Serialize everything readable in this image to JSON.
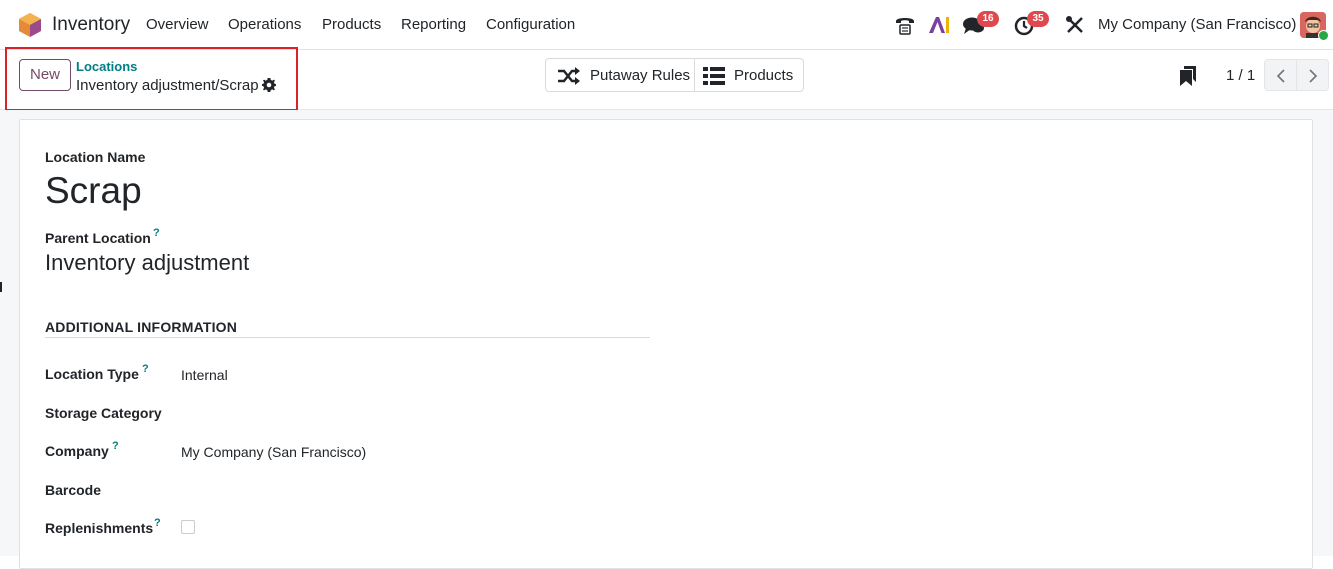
{
  "app": {
    "name": "Inventory"
  },
  "menu": [
    "Overview",
    "Operations",
    "Products",
    "Reporting",
    "Configuration"
  ],
  "systray": {
    "discuss_badge": "16",
    "activity_badge": "35",
    "company": "My Company (San Francisco)"
  },
  "control": {
    "new_label": "New",
    "breadcrumb_parent": "Locations",
    "breadcrumb_current": "Inventory adjustment/Scrap",
    "smart_buttons": [
      "Putaway Rules",
      "Products"
    ],
    "pager": "1 / 1"
  },
  "form": {
    "name_label": "Location Name",
    "name_value": "Scrap",
    "parent_label": "Parent Location",
    "parent_value": "Inventory adjustment",
    "help_mark": "?",
    "section_title": "ADDITIONAL INFORMATION",
    "fields": [
      {
        "label": "Location Type",
        "value": "Internal"
      },
      {
        "label": "Storage Category",
        "value": ""
      },
      {
        "label": "Company",
        "value": "My Company (San Francisco)"
      },
      {
        "label": "Barcode",
        "value": ""
      },
      {
        "label": "Replenishments",
        "value": ""
      }
    ]
  },
  "colors": {
    "brand": "#714b67",
    "link": "#017e84",
    "badge": "#e0484f",
    "highlight": "#d9222a"
  }
}
